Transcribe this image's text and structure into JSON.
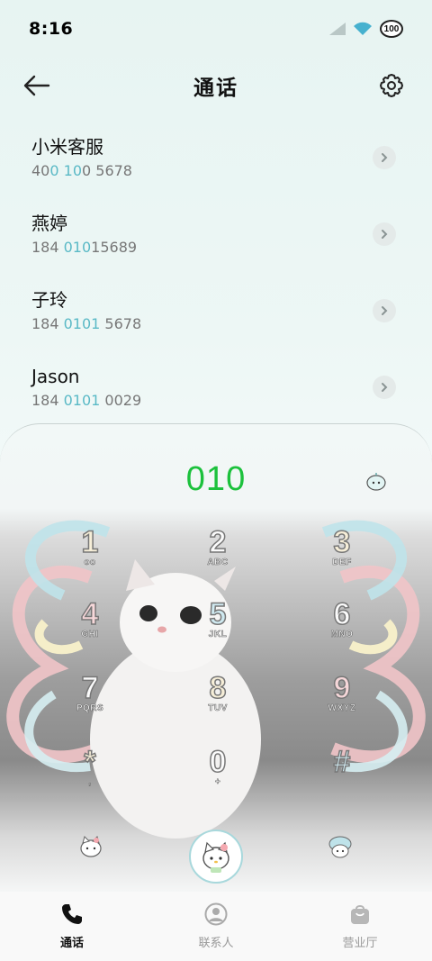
{
  "status_bar": {
    "time": "8:16",
    "battery": "100"
  },
  "header": {
    "title": "通话"
  },
  "calls": [
    {
      "name": "小米客服",
      "number_parts": [
        "40",
        "0",
        " ",
        "10",
        "0 5678"
      ]
    },
    {
      "name": "燕婷",
      "number_parts": [
        "184 ",
        "010",
        "15689",
        "",
        ""
      ]
    },
    {
      "name": "子玲",
      "number_parts": [
        "184 ",
        "0101",
        " 5678",
        "",
        ""
      ]
    },
    {
      "name": "Jason",
      "number_parts": [
        "184 ",
        "0101",
        " 0029",
        "",
        ""
      ]
    }
  ],
  "dialer": {
    "number": "010",
    "keys": [
      {
        "digit": "1",
        "letters": "oo"
      },
      {
        "digit": "2",
        "letters": "ABC"
      },
      {
        "digit": "3",
        "letters": "DEF"
      },
      {
        "digit": "4",
        "letters": "GHI"
      },
      {
        "digit": "5",
        "letters": "JKL"
      },
      {
        "digit": "6",
        "letters": "MNO"
      },
      {
        "digit": "7",
        "letters": "PQRS"
      },
      {
        "digit": "8",
        "letters": "TUV"
      },
      {
        "digit": "9",
        "letters": "WXYZ"
      },
      {
        "digit": "*",
        "letters": ","
      },
      {
        "digit": "0",
        "letters": "+"
      },
      {
        "digit": "#",
        "letters": ""
      }
    ]
  },
  "bottom_nav": [
    {
      "label": "通话",
      "icon": "phone-icon",
      "active": true
    },
    {
      "label": "联系人",
      "icon": "contact-icon",
      "active": false
    },
    {
      "label": "营业厅",
      "icon": "shopping-bag-icon",
      "active": false
    }
  ],
  "colors": {
    "accent_green": "#1cc13c",
    "highlight_teal": "#5ab9c6"
  }
}
